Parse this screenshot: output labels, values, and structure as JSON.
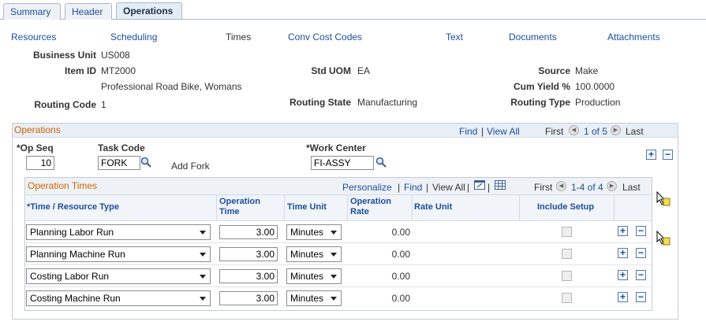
{
  "tabs": [
    {
      "label": "Summary",
      "active": false
    },
    {
      "label": "Header",
      "active": false
    },
    {
      "label": "Operations",
      "active": true
    }
  ],
  "subnav": [
    "Resources",
    "Scheduling",
    "Times",
    "Conv Cost Codes",
    "Text",
    "Documents",
    "Attachments"
  ],
  "subnav_current": "Times",
  "header": {
    "business_unit_label": "Business Unit",
    "business_unit": "US008",
    "item_id_label": "Item ID",
    "item_id": "MT2000",
    "item_desc": "Professional Road Bike, Womans",
    "routing_code_label": "Routing Code",
    "routing_code": "1",
    "std_uom_label": "Std UOM",
    "std_uom": "EA",
    "routing_state_label": "Routing State",
    "routing_state": "Manufacturing",
    "source_label": "Source",
    "source": "Make",
    "cum_yield_label": "Cum Yield %",
    "cum_yield": "100.0000",
    "routing_type_label": "Routing Type",
    "routing_type": "Production"
  },
  "operations": {
    "title": "Operations",
    "find": "Find",
    "sep": "|",
    "view_all": "View All",
    "first": "First",
    "counter": "1 of 5",
    "last": "Last",
    "op_seq_label": "*Op Seq",
    "op_seq": "10",
    "task_code_label": "Task Code",
    "task_code": "FORK",
    "task_desc": "Add Fork",
    "work_center_label": "*Work Center",
    "work_center": "FI-ASSY",
    "plus": "+",
    "minus": "−"
  },
  "op_times": {
    "title": "Operation Times",
    "personalize": "Personalize",
    "find": "Find",
    "view_all": "View All",
    "first": "First",
    "counter": "1-4 of 4",
    "last": "Last",
    "columns": {
      "type": "*Time / Resource Type",
      "op_time": "Operation Time",
      "time_unit": "Time Unit",
      "op_rate": "Operation Rate",
      "rate_unit": "Rate Unit",
      "include_setup": "Include Setup"
    },
    "rows": [
      {
        "type": "Planning Labor Run",
        "op_time": "3.00",
        "time_unit": "Minutes",
        "op_rate": "0.00"
      },
      {
        "type": "Planning Machine Run",
        "op_time": "3.00",
        "time_unit": "Minutes",
        "op_rate": "0.00"
      },
      {
        "type": "Costing Labor Run",
        "op_time": "3.00",
        "time_unit": "Minutes",
        "op_rate": "0.00"
      },
      {
        "type": "Costing Machine Run",
        "op_time": "3.00",
        "time_unit": "Minutes",
        "op_rate": "0.00"
      }
    ],
    "plus": "+",
    "minus": "−"
  },
  "icons": {
    "lookup": "magnifier-icon",
    "first_arrow": "arrow-left-icon",
    "next_arrow": "arrow-right-icon",
    "zoom": "zoom-window-icon",
    "download": "grid-download-icon",
    "help": "help-cursor-icon"
  },
  "colors": {
    "link": "#1c4e9c",
    "group_title": "#cc6600",
    "header_band": "#e8eef6"
  }
}
